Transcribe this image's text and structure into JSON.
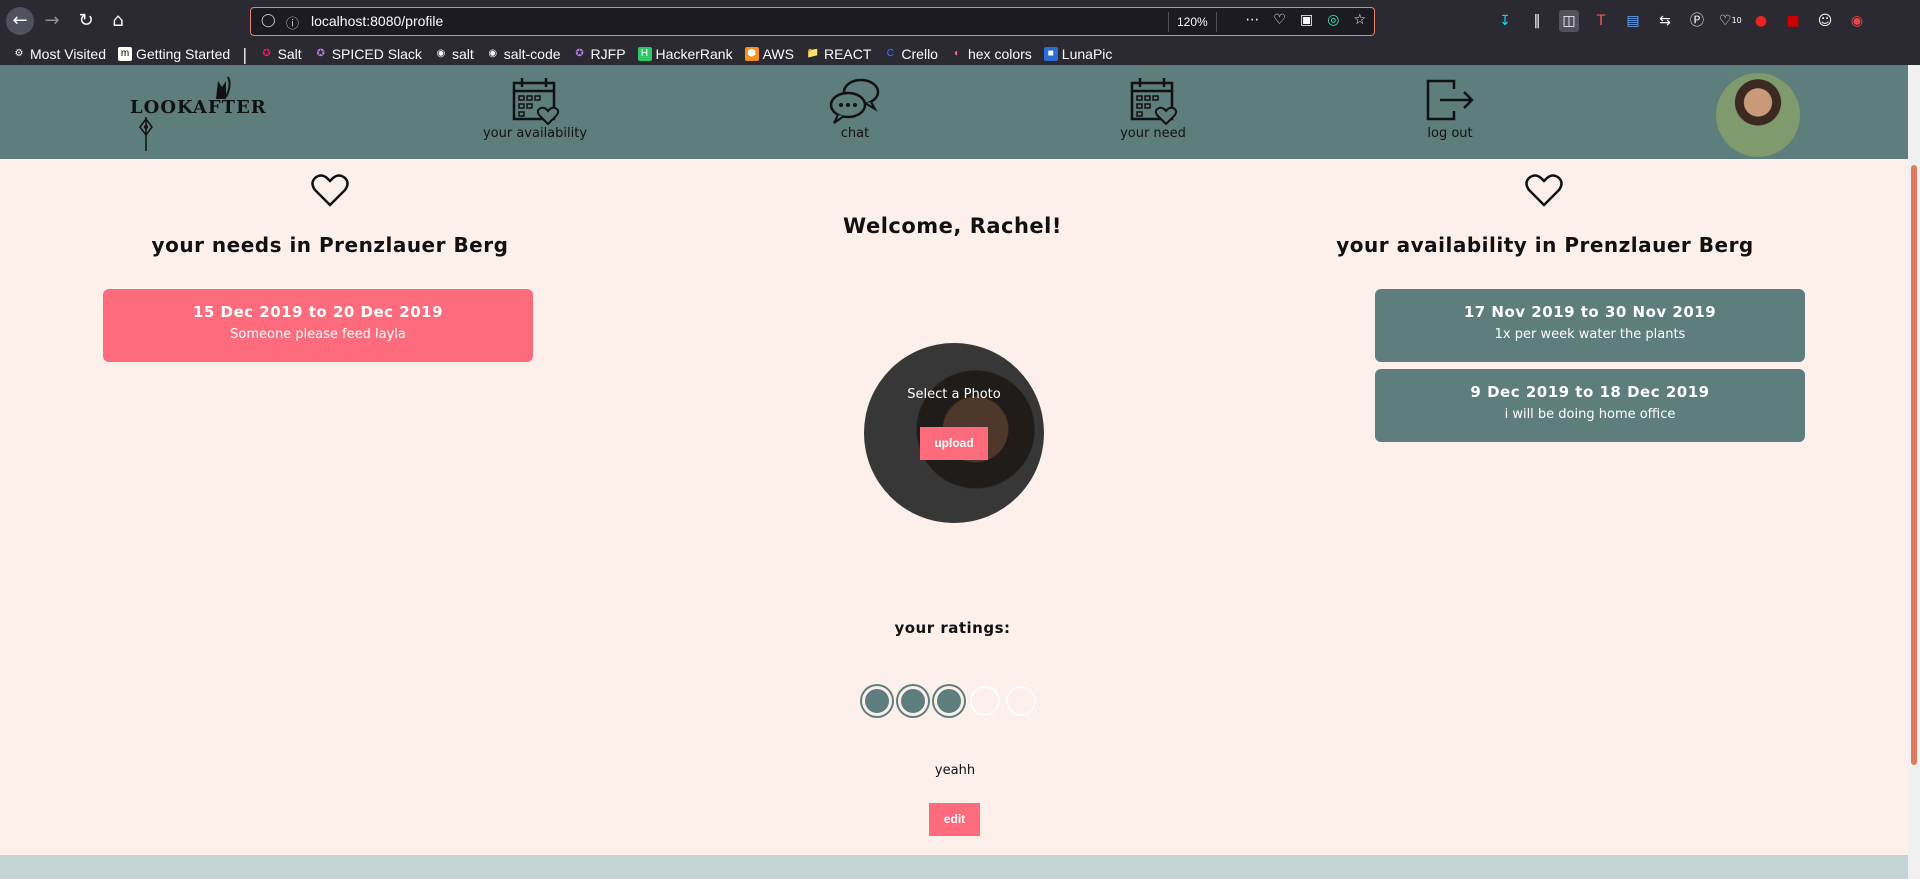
{
  "browser": {
    "url": "localhost:8080/profile",
    "zoom": "120%",
    "bookmarks": [
      {
        "label": "Most Visited",
        "icon": "gear-icon"
      },
      {
        "label": "Getting Started",
        "icon": "m-icon"
      },
      {
        "label": "Salt",
        "icon": "slack-icon"
      },
      {
        "label": "SPICED Slack",
        "icon": "slack-icon"
      },
      {
        "label": "salt",
        "icon": "github-icon"
      },
      {
        "label": "salt-code",
        "icon": "github-icon"
      },
      {
        "label": "RJFP",
        "icon": "slack-icon"
      },
      {
        "label": "HackerRank",
        "icon": "hackerrank-icon"
      },
      {
        "label": "AWS",
        "icon": "aws-icon"
      },
      {
        "label": "REACT",
        "icon": "folder-icon"
      },
      {
        "label": "Crello",
        "icon": "crello-icon"
      },
      {
        "label": "hex colors",
        "icon": "hex-icon"
      },
      {
        "label": "LunaPic",
        "icon": "lunapic-icon"
      }
    ],
    "pocket_badge": "10"
  },
  "app": {
    "logo": "LOOKAFTER",
    "nav": [
      {
        "label": "your availability",
        "icon": "calendar-heart-icon"
      },
      {
        "label": "chat",
        "icon": "chat-bubbles-icon"
      },
      {
        "label": "your need",
        "icon": "calendar-heart-icon"
      },
      {
        "label": "log out",
        "icon": "logout-icon"
      }
    ]
  },
  "profile": {
    "welcome": "Welcome, Rachel!",
    "photo_prompt": "Select a Photo",
    "upload_label": "upload",
    "ratings_title": "your ratings:",
    "rating": 3,
    "rating_max": 5,
    "rating_comment": "yeahh",
    "edit_label": "edit"
  },
  "needs": {
    "title": "your needs in Prenzlauer Berg",
    "items": [
      {
        "dates": "15 Dec 2019 to 20 Dec 2019",
        "desc": "Someone please feed layla"
      }
    ]
  },
  "availability": {
    "title": "your availability in Prenzlauer Berg",
    "items": [
      {
        "dates": "17 Nov 2019 to 30 Nov 2019",
        "desc": "1x per week water the plants"
      },
      {
        "dates": "9 Dec 2019 to 18 Dec 2019",
        "desc": "i will be doing home office"
      }
    ]
  },
  "colors": {
    "header": "#5e7d7d",
    "accent": "#fd6b7c",
    "background": "#fdefea"
  }
}
